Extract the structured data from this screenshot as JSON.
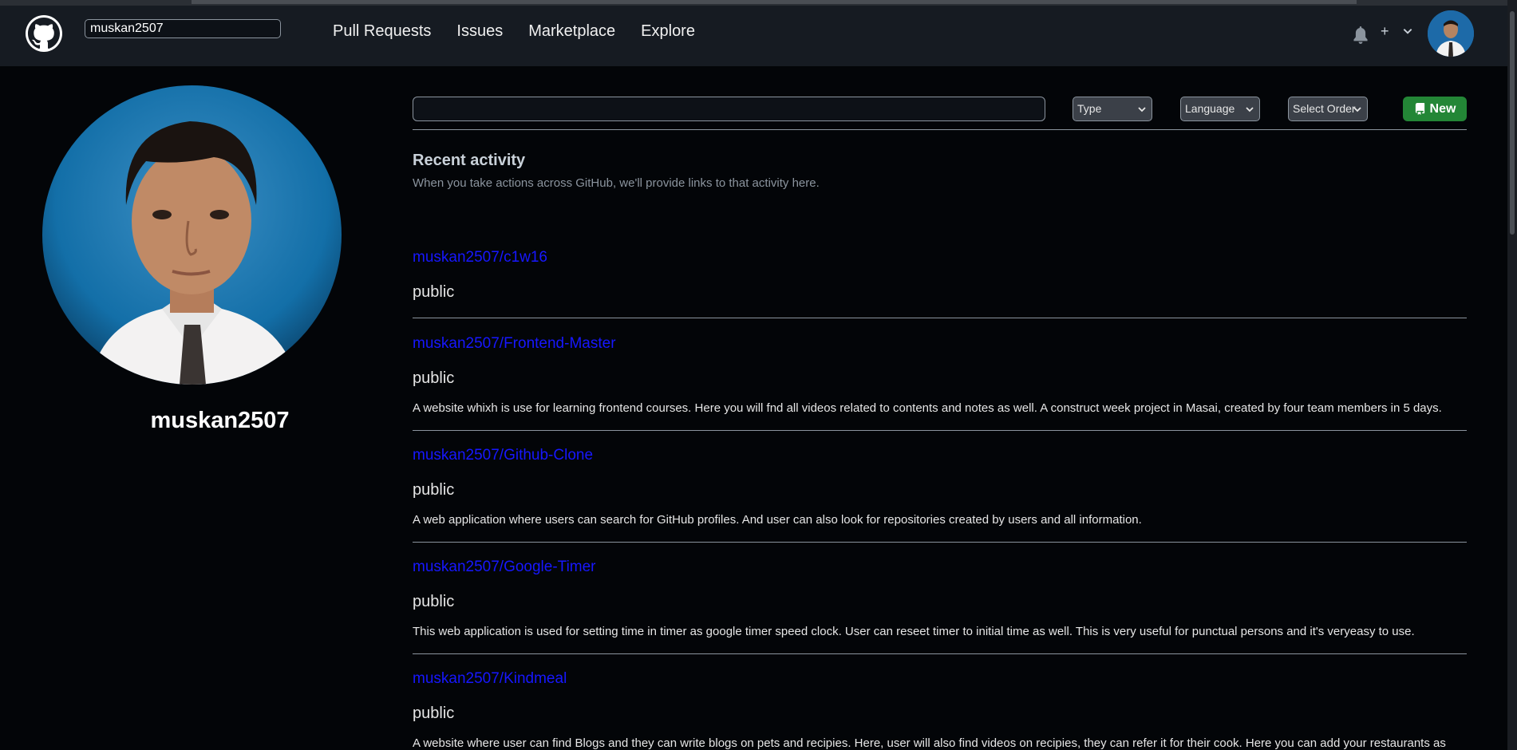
{
  "navbar": {
    "search_value": "muskan2507",
    "links": [
      "Pull Requests",
      "Issues",
      "Marketplace",
      "Explore"
    ],
    "plus_label": "+"
  },
  "profile": {
    "username": "muskan2507"
  },
  "filters": {
    "search_placeholder": "",
    "type_label": "Type",
    "language_label": "Language",
    "order_label": "Select Order",
    "new_label": "New"
  },
  "activity": {
    "title": "Recent activity",
    "subtitle": "When you take actions across GitHub, we'll provide links to that activity here."
  },
  "repos": [
    {
      "name": "muskan2507/c1w16",
      "visibility": "public",
      "description": ""
    },
    {
      "name": "muskan2507/Frontend-Master",
      "visibility": "public",
      "description": "A website whixh is use for learning frontend courses. Here you will fnd all videos related to contents and notes as well. A construct week project in Masai, created by four team members in 5 days."
    },
    {
      "name": "muskan2507/Github-Clone",
      "visibility": "public",
      "description": "A web application where users can search for GitHub profiles. And user can also look for repositories created by users and all information."
    },
    {
      "name": "muskan2507/Google-Timer",
      "visibility": "public",
      "description": "This web application is used for setting time in timer as google timer speed clock. User can reseet timer to initial time as well. This is very useful for punctual persons and it's veryeasy to use."
    },
    {
      "name": "muskan2507/Kindmeal",
      "visibility": "public",
      "description": "A website where user can find Blogs and they can write blogs on pets and recipies. Here, user will also find videos on recipies, they can refer it for their cook. Here you can add your restaurants as"
    }
  ],
  "colors": {
    "page_bg": "#030508",
    "navbar_bg": "#161b22",
    "link_blue": "#1717ff",
    "new_button_green": "#238636"
  },
  "icons": [
    "github-logo-icon",
    "bell-icon",
    "plus-icon",
    "chevron-down-icon",
    "repo-book-icon"
  ]
}
